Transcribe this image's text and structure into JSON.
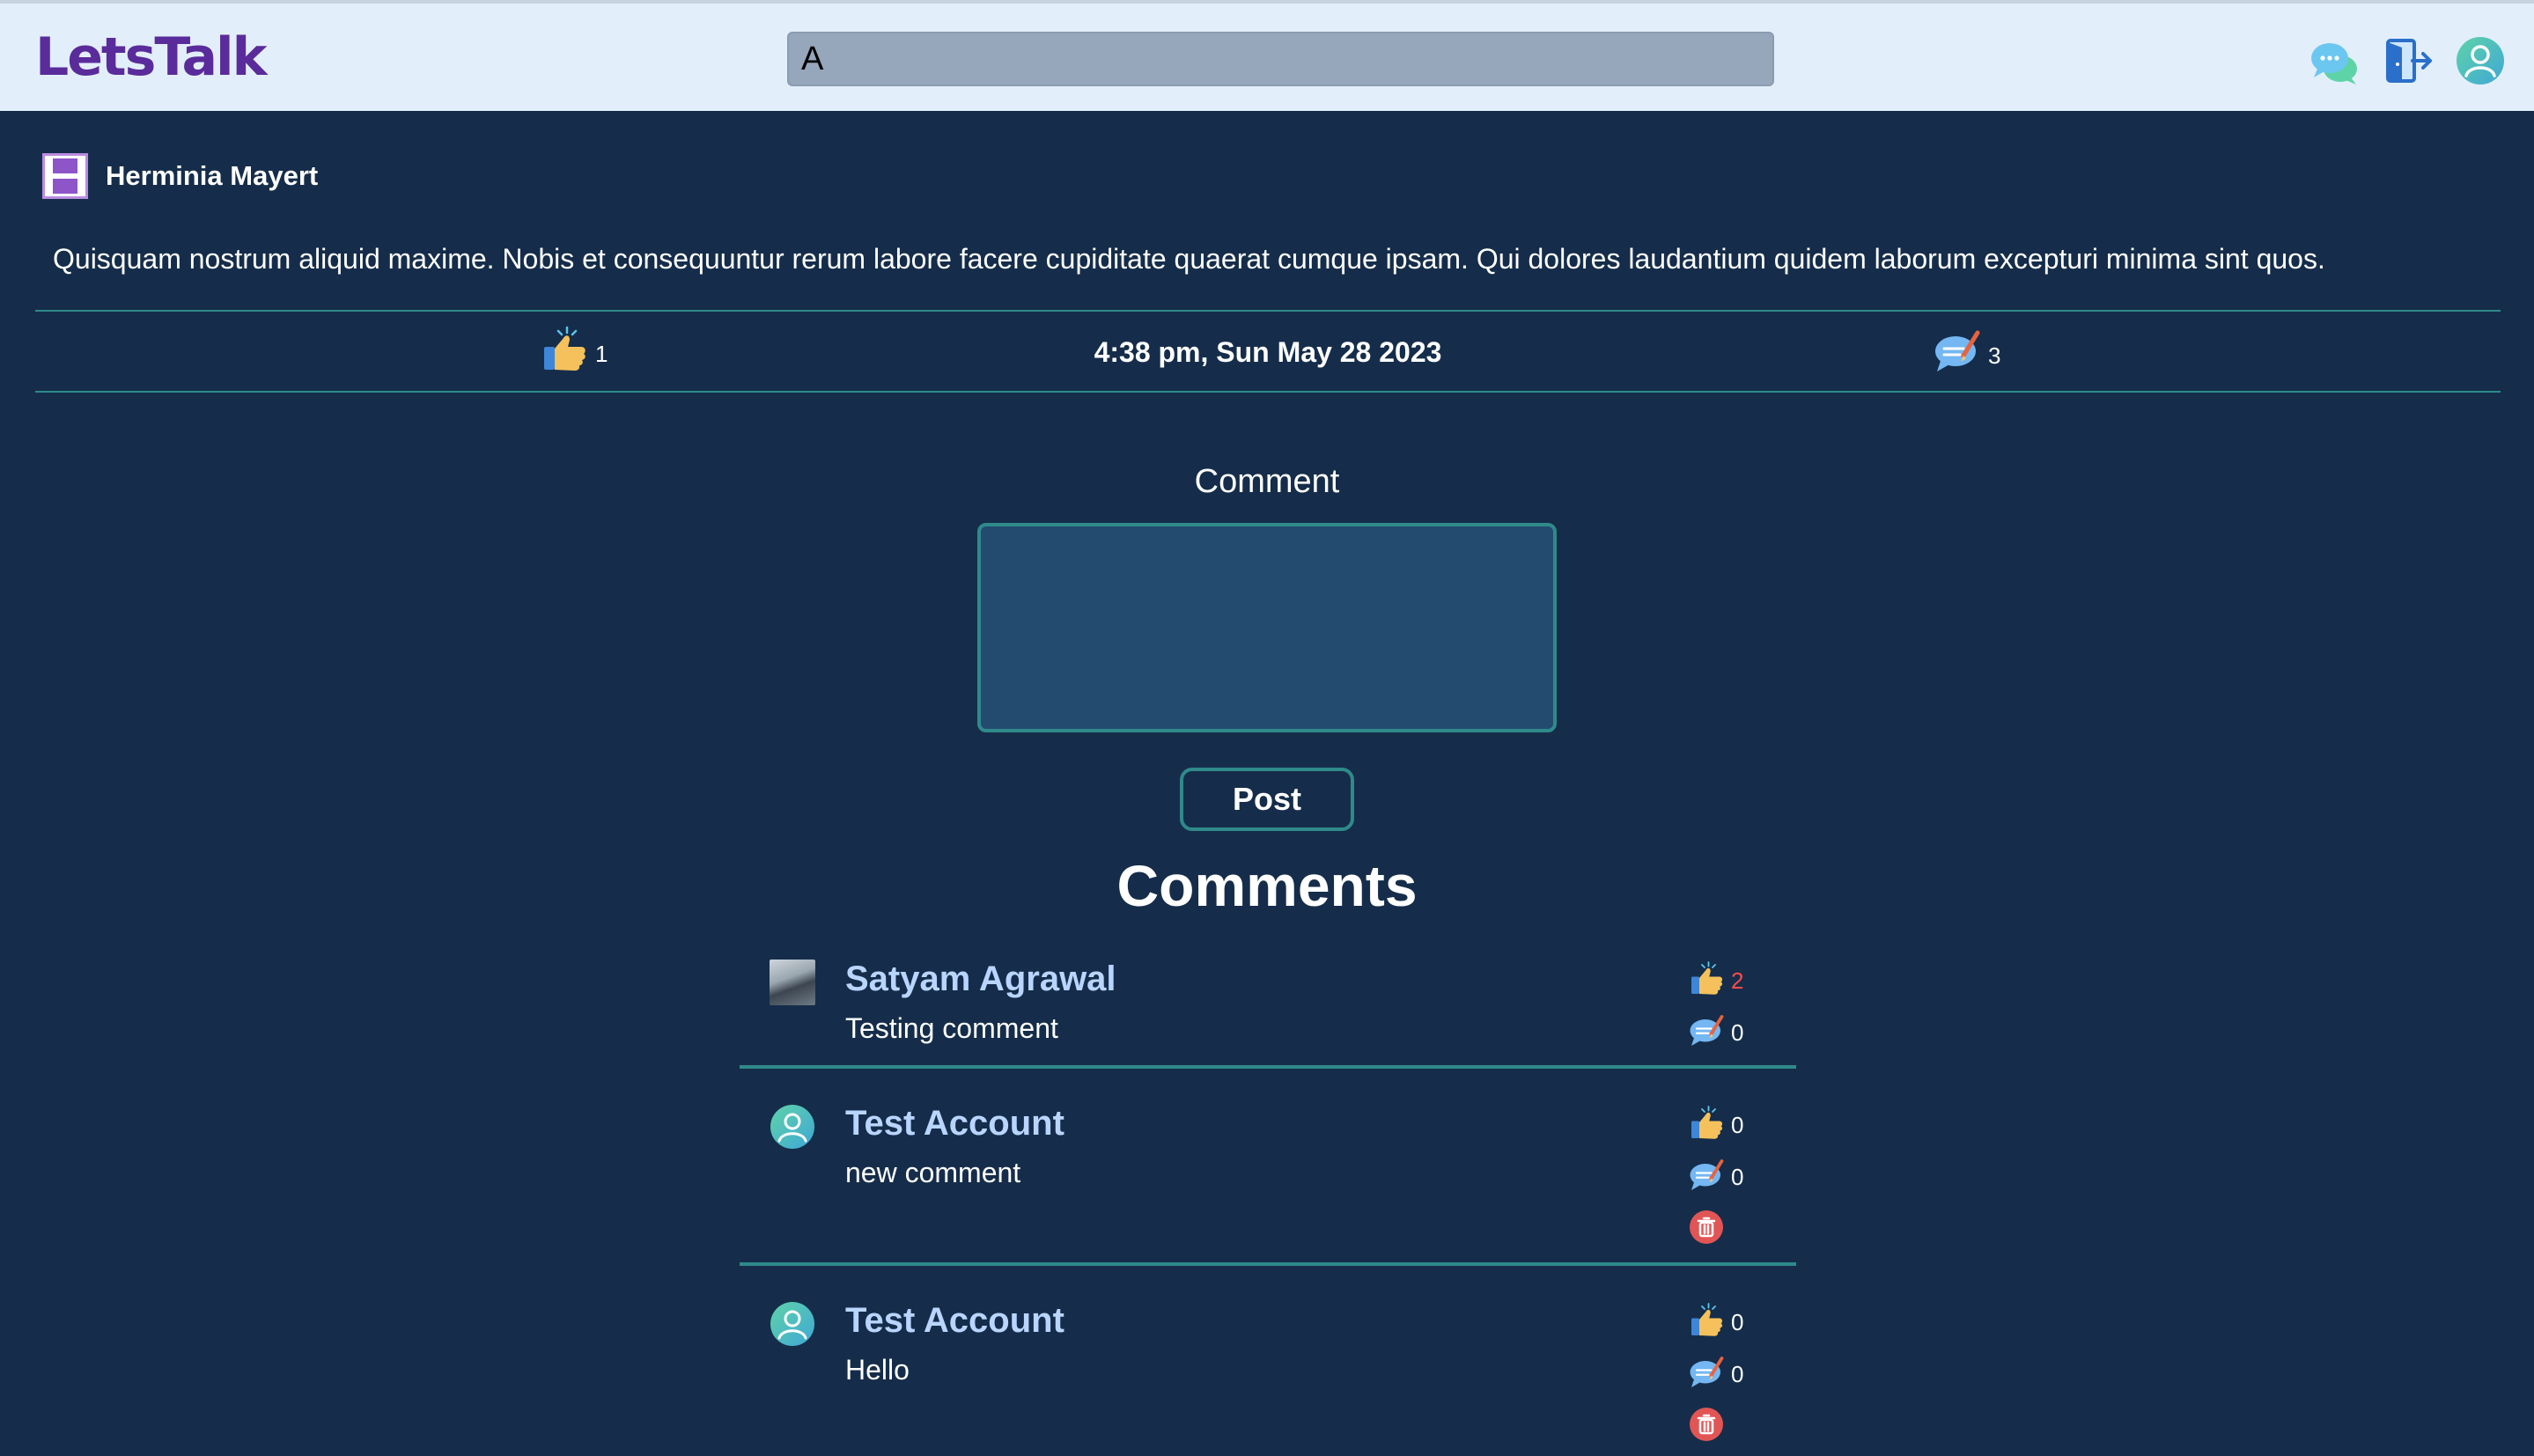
{
  "header": {
    "logo": "LetsTalk",
    "search_value": "A",
    "icons": [
      "chat-bubbles-icon",
      "logout-door-icon",
      "user-profile-icon"
    ]
  },
  "post": {
    "author": "Herminia Mayert",
    "body": "Quisquam nostrum aliquid maxime. Nobis et consequuntur rerum labore facere cupiditate quaerat cumque ipsam. Qui dolores laudantium quidem laborum excepturi minima sint quos.",
    "likes": "1",
    "timestamp": "4:38 pm, Sun May 28 2023",
    "comments_count": "3"
  },
  "comment_form": {
    "label": "Comment",
    "value": "",
    "post_label": "Post"
  },
  "comments_section": {
    "title": "Comments",
    "items": [
      {
        "name": "Satyam Agrawal",
        "text": "Testing comment",
        "likes": "2",
        "replies": "0",
        "avatar": "photo",
        "deletable": false
      },
      {
        "name": "Test Account",
        "text": "new comment",
        "likes": "0",
        "replies": "0",
        "avatar": "default-user-icon",
        "deletable": true
      },
      {
        "name": "Test Account",
        "text": "Hello",
        "likes": "0",
        "replies": "0",
        "avatar": "default-user-icon",
        "deletable": true
      }
    ]
  },
  "colors": {
    "background": "#152d4a",
    "header_bg": "#e2effb",
    "logo": "#5a2b9a",
    "accent_border": "#2f8a8a",
    "comment_name": "#b9d5ff",
    "like_highlight": "#ff4b4b",
    "delete": "#e25555"
  }
}
